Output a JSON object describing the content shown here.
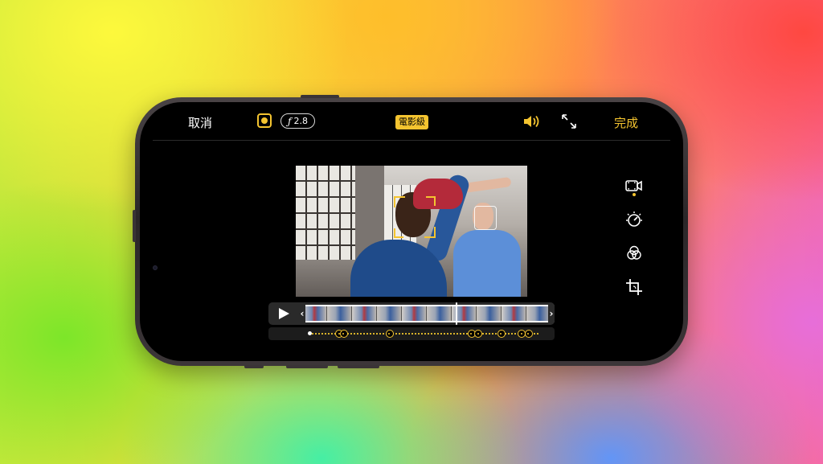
{
  "topbar": {
    "cancel_label": "取消",
    "aperture_symbol": "ƒ",
    "aperture_value": "2.8",
    "mode_label": "電影級",
    "done_label": "完成"
  },
  "icons": {
    "focus": "focus-lock-icon",
    "volume": "speaker-icon",
    "expand": "expand-arrows-icon",
    "tools": [
      "cinematic-camera-icon",
      "adjust-dial-icon",
      "filters-icon",
      "crop-rotate-icon"
    ]
  },
  "colors": {
    "accent": "#f4c430",
    "background": "#000000"
  },
  "timeline": {
    "thumbnail_count": 10,
    "playhead_position": 0.62
  },
  "focus_track": {
    "keyframes": [
      0.12,
      0.14,
      0.34,
      0.7,
      0.73,
      0.83,
      0.92,
      0.95
    ]
  }
}
